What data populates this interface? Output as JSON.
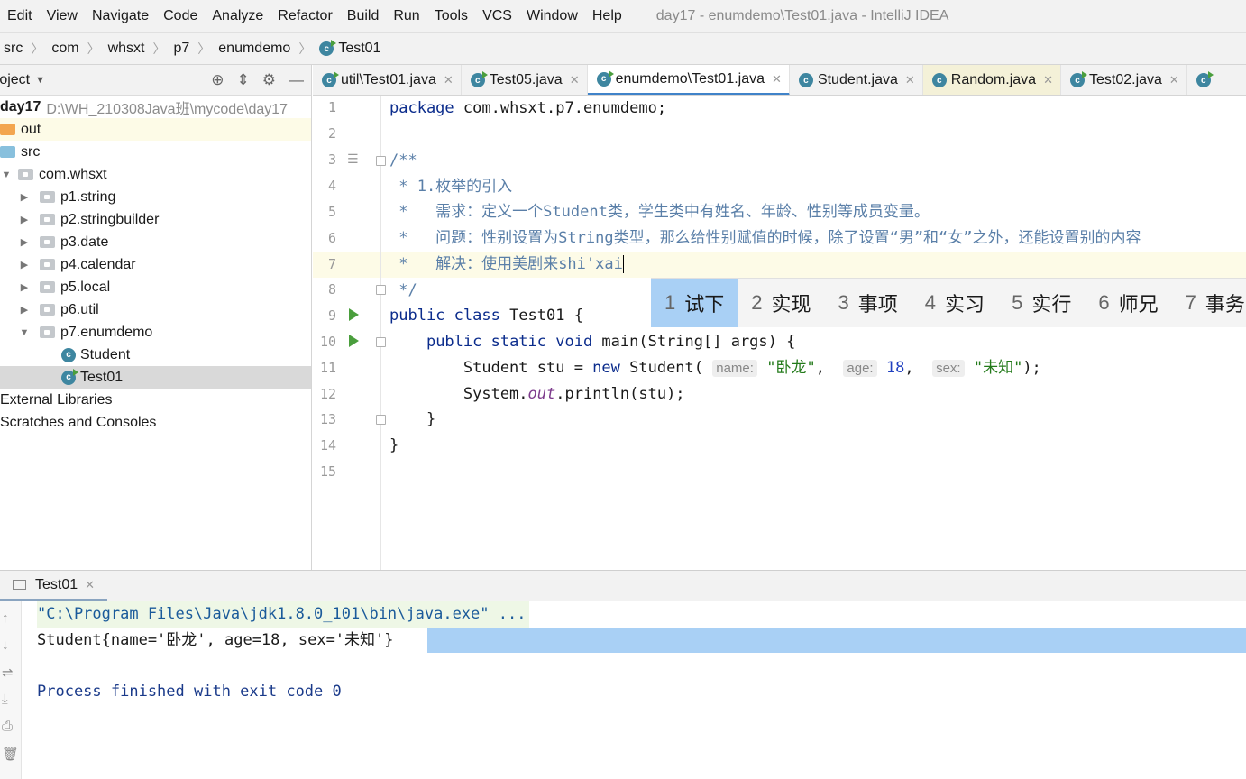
{
  "menu": {
    "items": [
      "Edit",
      "View",
      "Navigate",
      "Code",
      "Analyze",
      "Refactor",
      "Build",
      "Run",
      "Tools",
      "VCS",
      "Window",
      "Help"
    ],
    "window_title": "day17 - enumdemo\\Test01.java - IntelliJ IDEA"
  },
  "breadcrumb": [
    "src",
    "com",
    "whsxt",
    "p7",
    "enumdemo",
    "Test01"
  ],
  "project": {
    "title": "roject",
    "root_name": "day17",
    "root_path": "D:\\WH_210308Java班\\mycode\\day17",
    "out": "out",
    "src": "src",
    "pkg_root": "com.whsxt",
    "packages": [
      "p1.string",
      "p2.stringbuilder",
      "p3.date",
      "p4.calendar",
      "p5.local",
      "p6.util",
      "p7.enumdemo"
    ],
    "classes": [
      "Student",
      "Test01"
    ],
    "external": "External Libraries",
    "scratches": "Scratches and Consoles"
  },
  "tabs": [
    "util\\Test01.java",
    "Test05.java",
    "enumdemo\\Test01.java",
    "Student.java",
    "Random.java",
    "Test02.java"
  ],
  "code": {
    "line_numbers": [
      "1",
      "2",
      "3",
      "4",
      "5",
      "6",
      "7",
      "8",
      "9",
      "10",
      "11",
      "12",
      "13",
      "14",
      "15"
    ],
    "l1_kw": "package",
    "l1_rest": " com.whsxt.p7.enumdemo;",
    "l3": "/**",
    "l4": " * 1.枚举的引入",
    "l5": " *   需求：定义一个Student类，学生类中有姓名、年龄、性别等成员变量。",
    "l6": " *   问题：性别设置为String类型，那么给性别赋值的时候，除了设置“男”和“女”之外，还能设置别的内容",
    "l7_pre": " *   解决：使用美剧来",
    "l7_typed": "shi'xai",
    "l8": " */",
    "l9_kw": "public class",
    "l9_rest": " Test01 {",
    "l10_indent": "    ",
    "l10_kw": "public static void",
    "l10_rest": " main(String[] args) {",
    "l11_a": "        Student stu = ",
    "l11_new": "new",
    "l11_b": " Student( ",
    "l11_hint_name": "name:",
    "l11_val_name": "\"卧龙\"",
    "l11_comma": ",  ",
    "l11_hint_age": "age:",
    "l11_val_age": "18",
    "l11_hint_sex": "sex:",
    "l11_val_sex": "\"未知\"",
    "l11_end": ");",
    "l12_a": "        System.",
    "l12_out": "out",
    "l12_b": ".println(stu);",
    "l13": "    }",
    "l14": "}"
  },
  "ime": {
    "candidates": [
      {
        "n": "1",
        "w": "试下"
      },
      {
        "n": "2",
        "w": "实现"
      },
      {
        "n": "3",
        "w": "事项"
      },
      {
        "n": "4",
        "w": "实习"
      },
      {
        "n": "5",
        "w": "实行"
      },
      {
        "n": "6",
        "w": "师兄"
      },
      {
        "n": "7",
        "w": "事务"
      }
    ]
  },
  "run": {
    "tab": "Test01",
    "cmd": "\"C:\\Program Files\\Java\\jdk1.8.0_101\\bin\\java.exe\" ...",
    "result": "Student{name='卧龙', age=18, sex='未知'}",
    "exit": "Process finished with exit code 0"
  }
}
